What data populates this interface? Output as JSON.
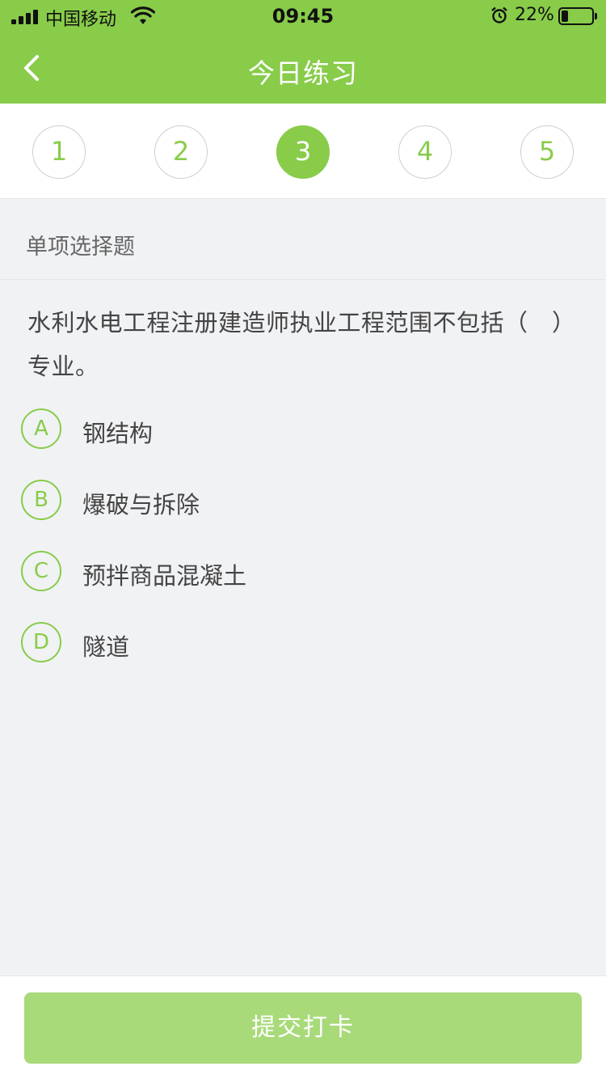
{
  "status_bar": {
    "carrier": "中国移动",
    "time": "09:45",
    "battery_percent": "22%",
    "battery_level": 0.22,
    "icons": [
      "signal-icon",
      "wifi-icon",
      "alarm-icon",
      "battery-icon"
    ]
  },
  "nav": {
    "title": "今日练习",
    "back_icon": "chevron-left-icon"
  },
  "steps": {
    "items": [
      "1",
      "2",
      "3",
      "4",
      "5"
    ],
    "active_index": 2
  },
  "question": {
    "type": "单项选择题",
    "text": "水利水电工程注册建造师执业工程范围不包括（　）专业。",
    "options": [
      {
        "letter": "A",
        "text": "钢结构"
      },
      {
        "letter": "B",
        "text": "爆破与拆除"
      },
      {
        "letter": "C",
        "text": "预拌商品混凝土"
      },
      {
        "letter": "D",
        "text": "隧道"
      }
    ]
  },
  "footer": {
    "submit_label": "提交打卡"
  },
  "colors": {
    "accent": "#88cc4a",
    "button_disabled": "#a8da7a",
    "background": "#f1f2f4"
  }
}
